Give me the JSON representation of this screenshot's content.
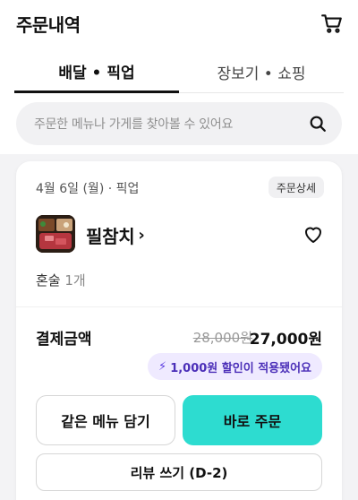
{
  "header": {
    "title": "주문내역",
    "cart_icon": "cart-icon"
  },
  "tabs": [
    {
      "label": "배달 • 픽업",
      "active": true
    },
    {
      "label": "장보기 • 쇼핑",
      "active": false
    }
  ],
  "search": {
    "placeholder": "주문한 메뉴나 가게를 찾아볼 수 있어요",
    "icon": "search-icon"
  },
  "order": {
    "meta": "4월 6일 (월) · 픽업",
    "detail_label": "주문상세",
    "store_name": "필참치",
    "chevron": "›",
    "item_name": "혼술",
    "item_qty": "1개",
    "payment_label": "결제금액",
    "original_price": "28,000원",
    "final_price": "27,000원",
    "discount_text": "1,000원 할인이 적용됐어요",
    "discount_icon": "lightning-icon",
    "same_menu_label": "같은 메뉴 담기",
    "reorder_label": "바로 주문",
    "review_label": "리뷰 쓰기 (D-2)"
  },
  "colors": {
    "accent": "#2ddcd0",
    "discount_bg": "#efeaff",
    "discount_text": "#4b2fb8"
  }
}
